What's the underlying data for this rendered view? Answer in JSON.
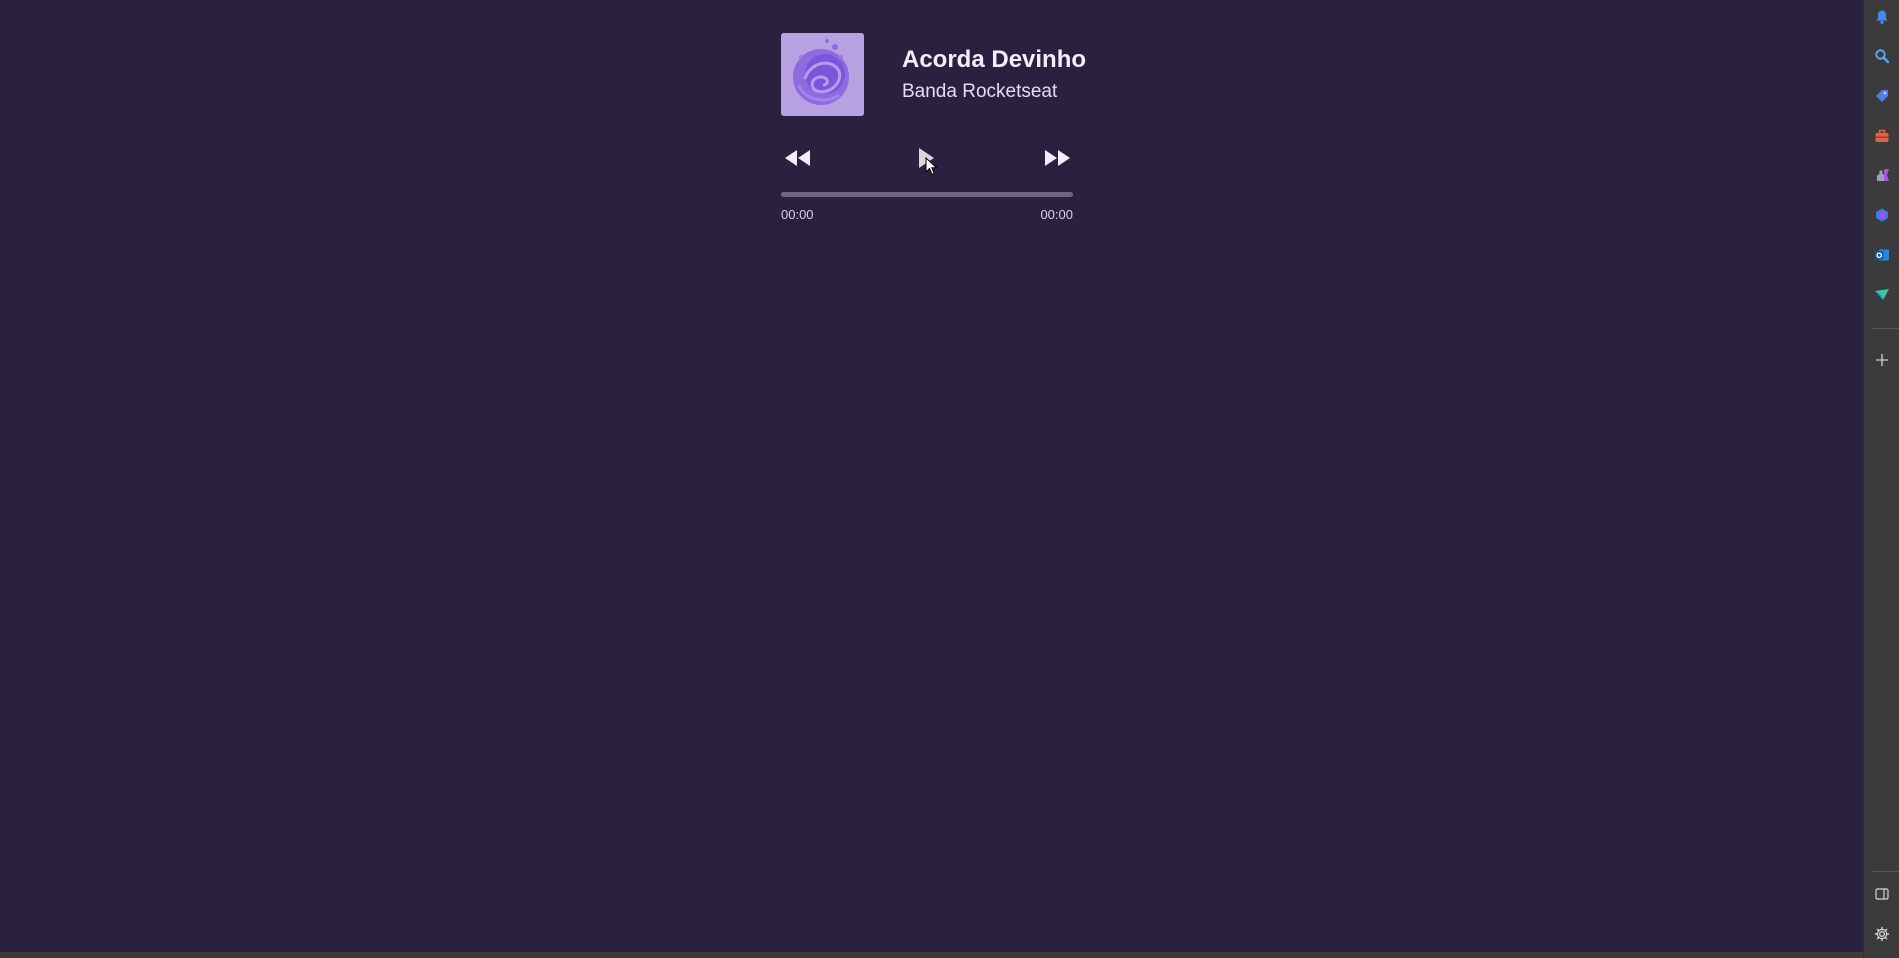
{
  "player": {
    "title": "Acorda Devinho",
    "artist": "Banda Rocketseat",
    "cover_icon": "album-cover-image",
    "controls": {
      "previous_icon": "rewind-icon",
      "play_icon": "play-icon",
      "next_icon": "fast-forward-icon"
    },
    "progress": {
      "fraction": 0,
      "current_time": "00:00",
      "duration": "00:00"
    }
  },
  "sidebar": {
    "items": [
      {
        "icon": "bell-icon"
      },
      {
        "icon": "search-icon"
      },
      {
        "icon": "shopping-tag-icon"
      },
      {
        "icon": "toolbox-icon"
      },
      {
        "icon": "games-icon"
      },
      {
        "icon": "copilot-icon"
      },
      {
        "icon": "outlook-icon"
      },
      {
        "icon": "send-icon"
      }
    ],
    "add_icon": "plus-icon",
    "bottom_items": [
      {
        "icon": "sidebar-toggle-icon"
      },
      {
        "icon": "gear-icon"
      }
    ]
  },
  "colors": {
    "background": "#2a2141",
    "accent": "#8a6fe0",
    "sidebar": "#3b3b3b"
  }
}
